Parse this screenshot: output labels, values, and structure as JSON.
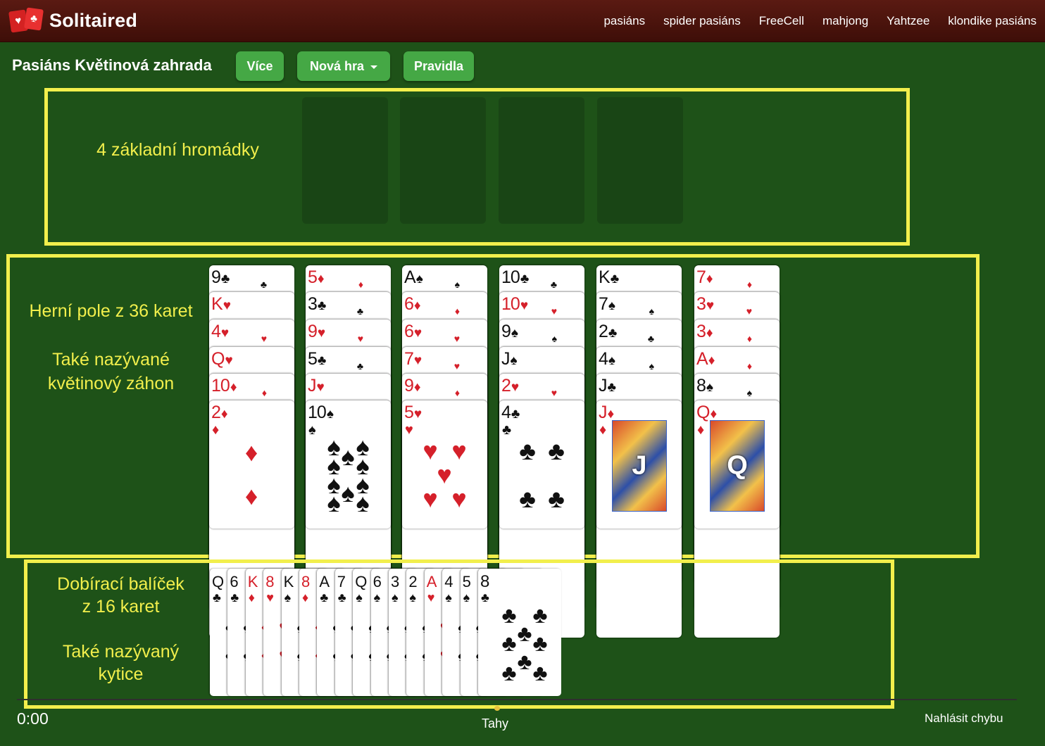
{
  "header": {
    "logo_text": "Solitaired",
    "nav": [
      "pasiáns",
      "spider pasiáns",
      "FreeCell",
      "mahjong",
      "Yahtzee",
      "klondike pasiáns"
    ]
  },
  "toolbar": {
    "title": "Pasiáns Květinová zahrada",
    "more_label": "Více",
    "new_game_label": "Nová hra",
    "rules_label": "Pravidla"
  },
  "annotations": {
    "foundations": "4 základní hromádky",
    "field_line1": "Herní pole z 36 karet",
    "field_line2": "Také nazývané",
    "field_line3": "květinový záhon",
    "stock_line1": "Dobírací balíček",
    "stock_line2": "z 16 karet",
    "stock_line3": "Také nazývaný",
    "stock_line4": "kytice"
  },
  "colors": {
    "accent": "#f2ef4c",
    "button": "#45a845",
    "table": "#1e5218",
    "header": "#4c140d"
  },
  "tableau": [
    [
      {
        "r": "9",
        "s": "♣"
      },
      {
        "r": "K",
        "s": "♥"
      },
      {
        "r": "4",
        "s": "♥"
      },
      {
        "r": "Q",
        "s": "♥"
      },
      {
        "r": "10",
        "s": "♦"
      },
      {
        "r": "2",
        "s": "♦"
      }
    ],
    [
      {
        "r": "5",
        "s": "♦"
      },
      {
        "r": "3",
        "s": "♣"
      },
      {
        "r": "9",
        "s": "♥"
      },
      {
        "r": "5",
        "s": "♣"
      },
      {
        "r": "J",
        "s": "♥"
      },
      {
        "r": "10",
        "s": "♠"
      }
    ],
    [
      {
        "r": "A",
        "s": "♠"
      },
      {
        "r": "6",
        "s": "♦"
      },
      {
        "r": "6",
        "s": "♥"
      },
      {
        "r": "7",
        "s": "♥"
      },
      {
        "r": "9",
        "s": "♦"
      },
      {
        "r": "5",
        "s": "♥"
      }
    ],
    [
      {
        "r": "10",
        "s": "♣"
      },
      {
        "r": "10",
        "s": "♥"
      },
      {
        "r": "9",
        "s": "♠"
      },
      {
        "r": "J",
        "s": "♠"
      },
      {
        "r": "2",
        "s": "♥"
      },
      {
        "r": "4",
        "s": "♣"
      }
    ],
    [
      {
        "r": "K",
        "s": "♣"
      },
      {
        "r": "7",
        "s": "♠"
      },
      {
        "r": "2",
        "s": "♣"
      },
      {
        "r": "4",
        "s": "♠"
      },
      {
        "r": "J",
        "s": "♣"
      },
      {
        "r": "J",
        "s": "♦"
      }
    ],
    [
      {
        "r": "7",
        "s": "♦"
      },
      {
        "r": "3",
        "s": "♥"
      },
      {
        "r": "3",
        "s": "♦"
      },
      {
        "r": "A",
        "s": "♦"
      },
      {
        "r": "8",
        "s": "♠"
      },
      {
        "r": "Q",
        "s": "♦"
      }
    ]
  ],
  "stock": [
    {
      "r": "Q",
      "s": "♣"
    },
    {
      "r": "6",
      "s": "♣"
    },
    {
      "r": "K",
      "s": "♦"
    },
    {
      "r": "8",
      "s": "♥"
    },
    {
      "r": "K",
      "s": "♠"
    },
    {
      "r": "8",
      "s": "♦"
    },
    {
      "r": "A",
      "s": "♣"
    },
    {
      "r": "7",
      "s": "♣"
    },
    {
      "r": "Q",
      "s": "♠"
    },
    {
      "r": "6",
      "s": "♠"
    },
    {
      "r": "3",
      "s": "♠"
    },
    {
      "r": "2",
      "s": "♠"
    },
    {
      "r": "A",
      "s": "♥"
    },
    {
      "r": "4",
      "s": "♠"
    },
    {
      "r": "5",
      "s": "♠"
    },
    {
      "r": "8",
      "s": "♣"
    }
  ],
  "status": {
    "timer": "0:00",
    "moves_label": "Tahy",
    "report_label": "Nahlásit chybu"
  }
}
